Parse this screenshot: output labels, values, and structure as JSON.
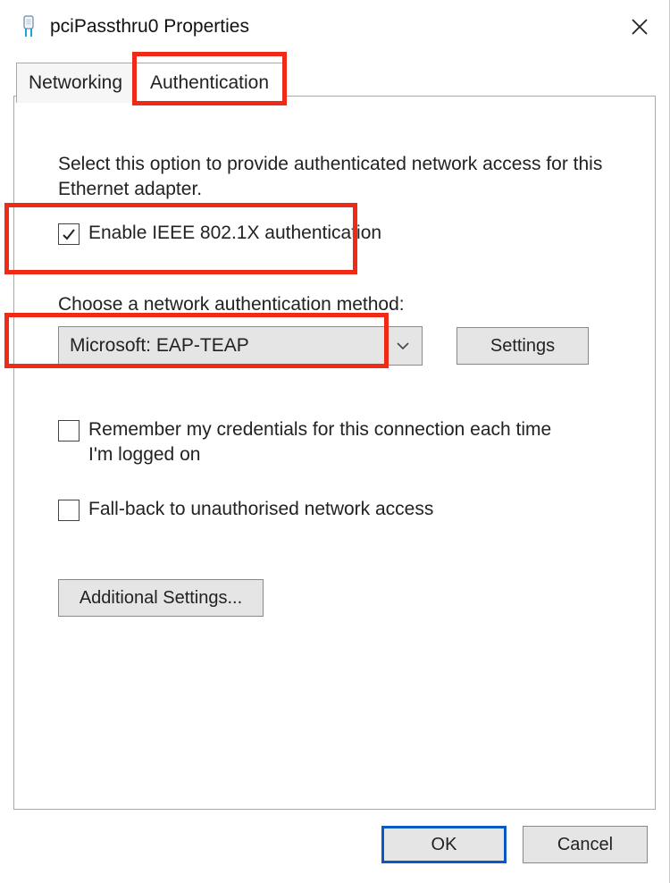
{
  "title": "pciPassthru0 Properties",
  "tabs": {
    "networking": "Networking",
    "authentication": "Authentication"
  },
  "intro": "Select this option to provide authenticated network access for this Ethernet adapter.",
  "enable_label": "Enable IEEE 802.1X authentication",
  "choose_label": "Choose a network authentication method:",
  "method_selected": "Microsoft: EAP-TEAP",
  "settings_btn": "Settings",
  "remember_label": "Remember my credentials for this connection each time I'm logged on",
  "fallback_label": "Fall-back to unauthorised network access",
  "additional_btn": "Additional Settings...",
  "ok_btn": "OK",
  "cancel_btn": "Cancel",
  "checks": {
    "enable": true,
    "remember": false,
    "fallback": false
  },
  "highlight_color": "#ef2b18"
}
